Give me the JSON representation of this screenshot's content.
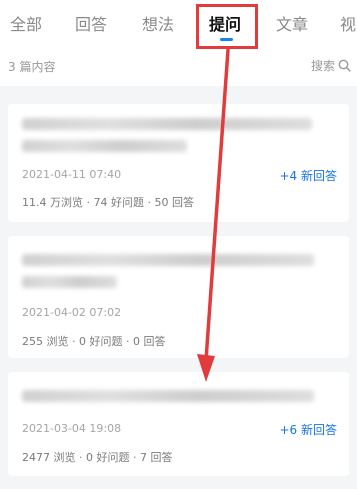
{
  "tabs": [
    {
      "label": "全部"
    },
    {
      "label": "回答"
    },
    {
      "label": "想法"
    },
    {
      "label": "提问"
    },
    {
      "label": "文章"
    },
    {
      "label": "视"
    }
  ],
  "list": {
    "count_label": "3 篇内容",
    "search_label": "搜索"
  },
  "cards": [
    {
      "date": "2021-04-11 07:40",
      "stats": "11.4 万浏览 · 74 好问题 · 50 回答",
      "new_label": "+4 新回答"
    },
    {
      "date": "2021-04-02 07:02",
      "stats": "255 浏览 · 0 好问题 · 0 回答",
      "new_label": ""
    },
    {
      "date": "2021-03-04 19:08",
      "stats": "2477 浏览 · 0 好问题 · 7 回答",
      "new_label": "+6 新回答"
    }
  ],
  "colors": {
    "accent": "#0f88eb",
    "link": "#1775e6",
    "annotation": "#e03c3c"
  },
  "icons": {
    "search": "search-icon"
  }
}
